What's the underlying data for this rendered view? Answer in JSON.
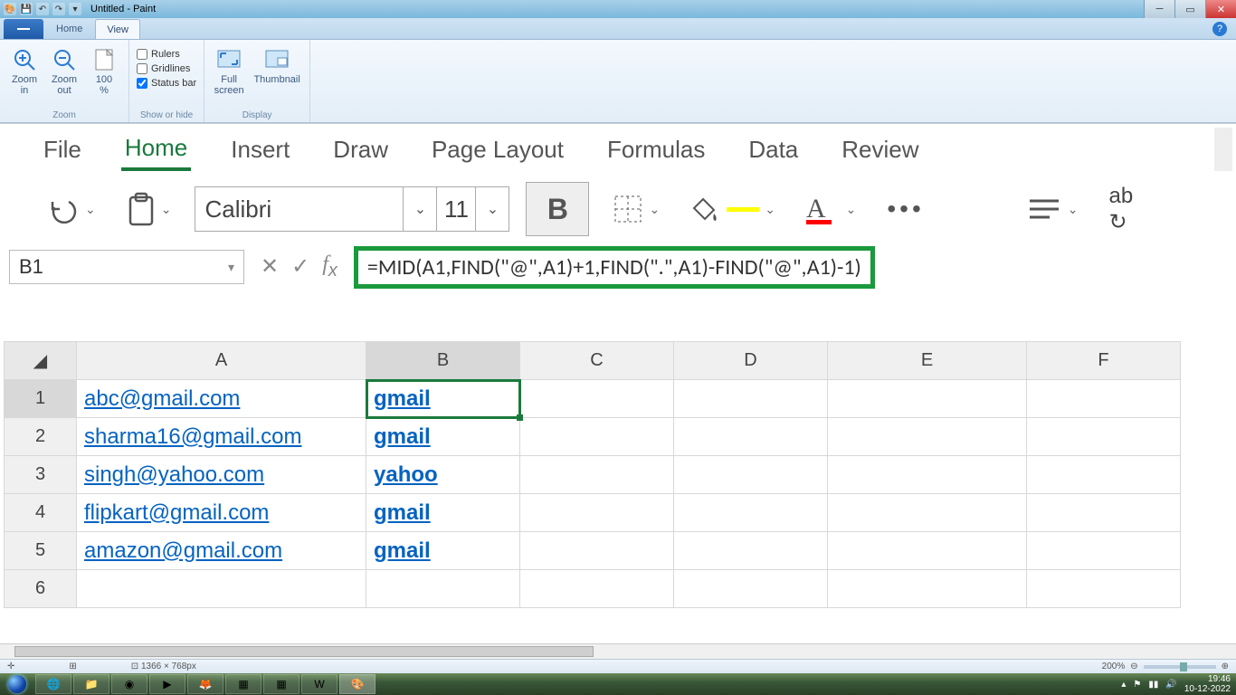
{
  "window": {
    "title": "Untitled - Paint"
  },
  "paint": {
    "tabs": {
      "home": "Home",
      "view": "View"
    },
    "ribbon": {
      "zoom_in": "Zoom\nin",
      "zoom_out": "Zoom\nout",
      "pct": "100\n%",
      "zoom_label": "Zoom",
      "rulers": "Rulers",
      "gridlines": "Gridlines",
      "statusbar": "Status bar",
      "showhide_label": "Show or hide",
      "fullscreen": "Full\nscreen",
      "thumbnail": "Thumbnail",
      "display_label": "Display"
    }
  },
  "excel": {
    "tabs": [
      "File",
      "Home",
      "Insert",
      "Draw",
      "Page Layout",
      "Formulas",
      "Data",
      "Review"
    ],
    "font": "Calibri",
    "size": "11",
    "bold": "B",
    "namebox": "B1",
    "formula": "=MID(A1,FIND(\"@\",A1)+1,FIND(\".\",A1)-FIND(\"@\",A1)-1)",
    "columns": [
      "A",
      "B",
      "C",
      "D",
      "E",
      "F"
    ],
    "rows": [
      {
        "n": "1",
        "a": "abc@gmail.com",
        "b": "gmail"
      },
      {
        "n": "2",
        "a": "sharma16@gmail.com",
        "b": "gmail"
      },
      {
        "n": "3",
        "a": "singh@yahoo.com",
        "b": "yahoo"
      },
      {
        "n": "4",
        "a": "flipkart@gmail.com",
        "b": "gmail"
      },
      {
        "n": "5",
        "a": "amazon@gmail.com",
        "b": "gmail"
      },
      {
        "n": "6",
        "a": "",
        "b": ""
      }
    ]
  },
  "status": {
    "dims": "1366 × 768px",
    "zoom": "200%"
  },
  "tray": {
    "time": "19:46",
    "date": "10-12-2022"
  }
}
